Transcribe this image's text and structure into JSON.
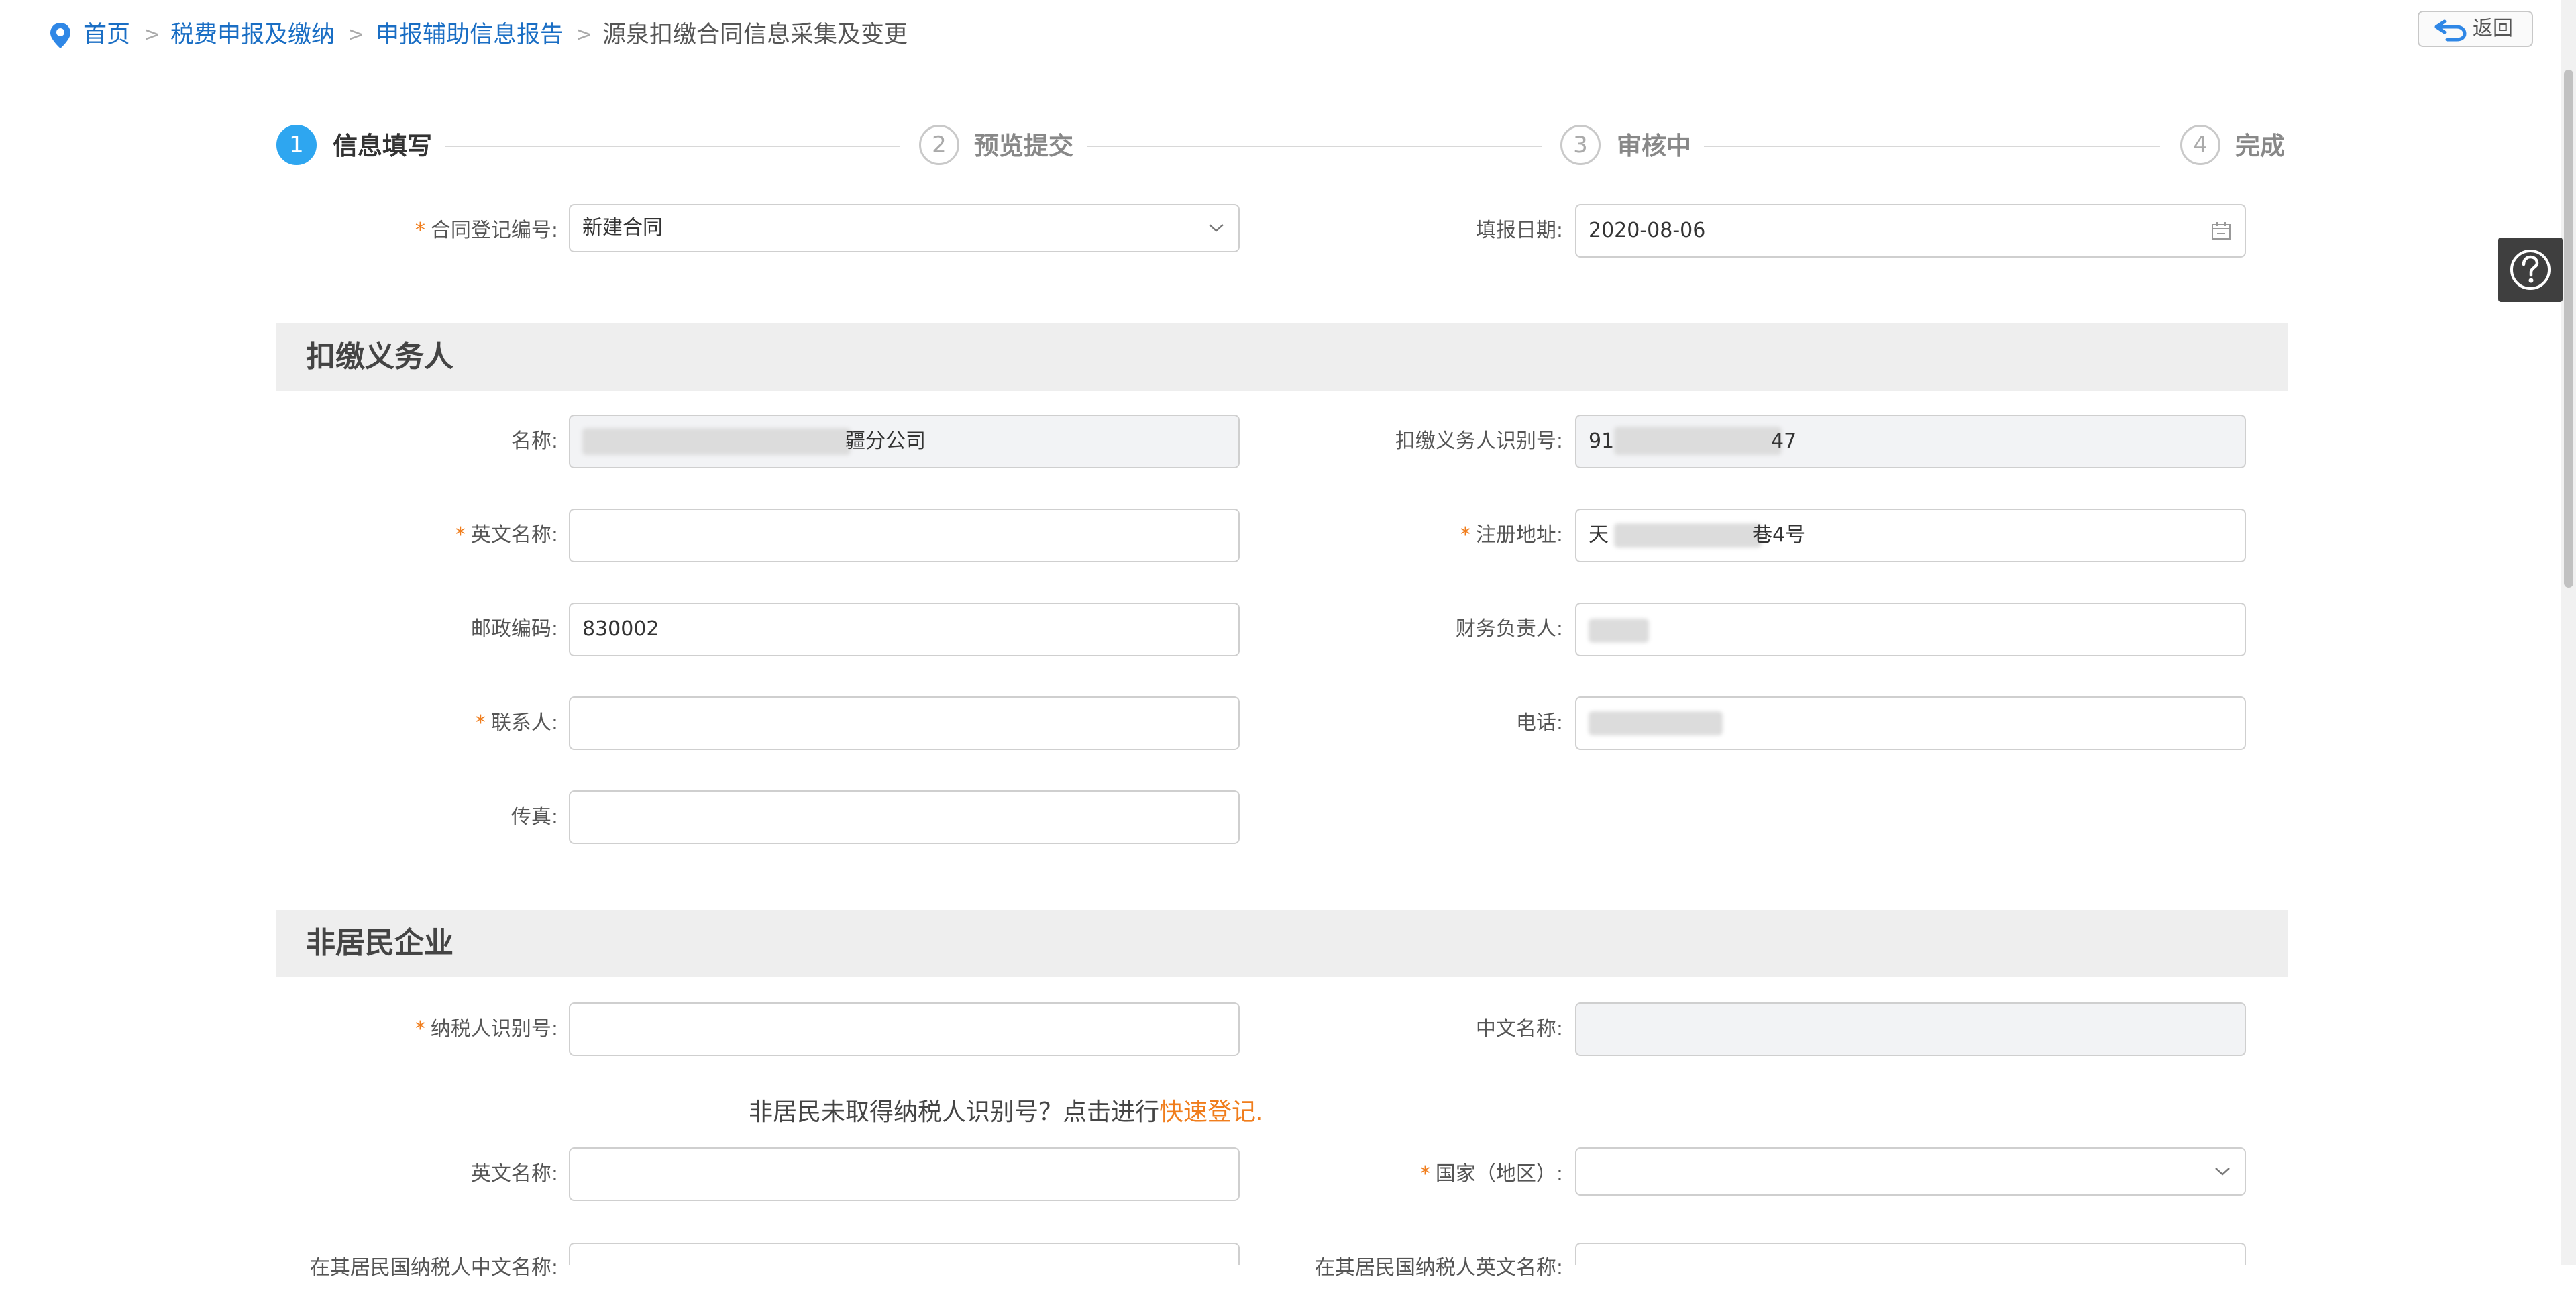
{
  "breadcrumb": {
    "home": "首页",
    "level1": "税费申报及缴纳",
    "level2": "申报辅助信息报告",
    "current": "源泉扣缴合同信息采集及变更",
    "separator": ">"
  },
  "back_button": {
    "label": "返回"
  },
  "steps": [
    {
      "number": "1",
      "label": "信息填写",
      "state": "active"
    },
    {
      "number": "2",
      "label": "预览提交",
      "state": "pending"
    },
    {
      "number": "3",
      "label": "审核中",
      "state": "pending"
    },
    {
      "number": "4",
      "label": "完成",
      "state": "pending"
    }
  ],
  "top_form": {
    "contract_no": {
      "label": "合同登记编号:",
      "value": "新建合同",
      "required": true
    },
    "fill_date": {
      "label": "填报日期:",
      "value": "2020-08-06"
    }
  },
  "withholding_agent": {
    "title": "扣缴义务人",
    "name": {
      "label": "名称:",
      "value": "疆分公司"
    },
    "agent_id": {
      "label": "扣缴义务人识别号:",
      "value_prefix": "91",
      "value_suffix": "47"
    },
    "english_name": {
      "label": "英文名称:",
      "value": "",
      "required": true
    },
    "reg_address": {
      "label": "注册地址:",
      "value_prefix": "天",
      "value_suffix": "巷4号",
      "required": true
    },
    "postcode": {
      "label": "邮政编码:",
      "value": "830002"
    },
    "finance_head": {
      "label": "财务负责人:",
      "value": ""
    },
    "contact": {
      "label": "联系人:",
      "value": "",
      "required": true
    },
    "phone": {
      "label": "电话:",
      "value": ""
    },
    "fax": {
      "label": "传真:",
      "value": ""
    }
  },
  "nonresident": {
    "title": "非居民企业",
    "taxpayer_id": {
      "label": "纳税人识别号:",
      "value": "",
      "required": true
    },
    "chinese_name": {
      "label": "中文名称:",
      "value": ""
    },
    "notice_text": "非居民未取得纳税人识别号？点击进行",
    "notice_link": "快速登记.",
    "english_name": {
      "label": "英文名称:",
      "value": ""
    },
    "country": {
      "label": "国家（地区）:",
      "value": "",
      "required": true
    },
    "resident_chinese_name": {
      "label": "在其居民国纳税人中文名称:"
    },
    "resident_english_name": {
      "label": "在其居民国纳税人英文名称:"
    }
  },
  "colors": {
    "link": "#1a6ec4",
    "accent_step": "#2ea6f0",
    "required_mark": "#f07d1c",
    "section_bar": "#eeeeee",
    "readonly_field": "#f2f3f5"
  },
  "icons": {
    "location": "location-pin-icon",
    "back": "return-arrow-icon",
    "help": "question-circle-icon",
    "calendar": "calendar-icon",
    "dropdown": "chevron-down-icon"
  }
}
